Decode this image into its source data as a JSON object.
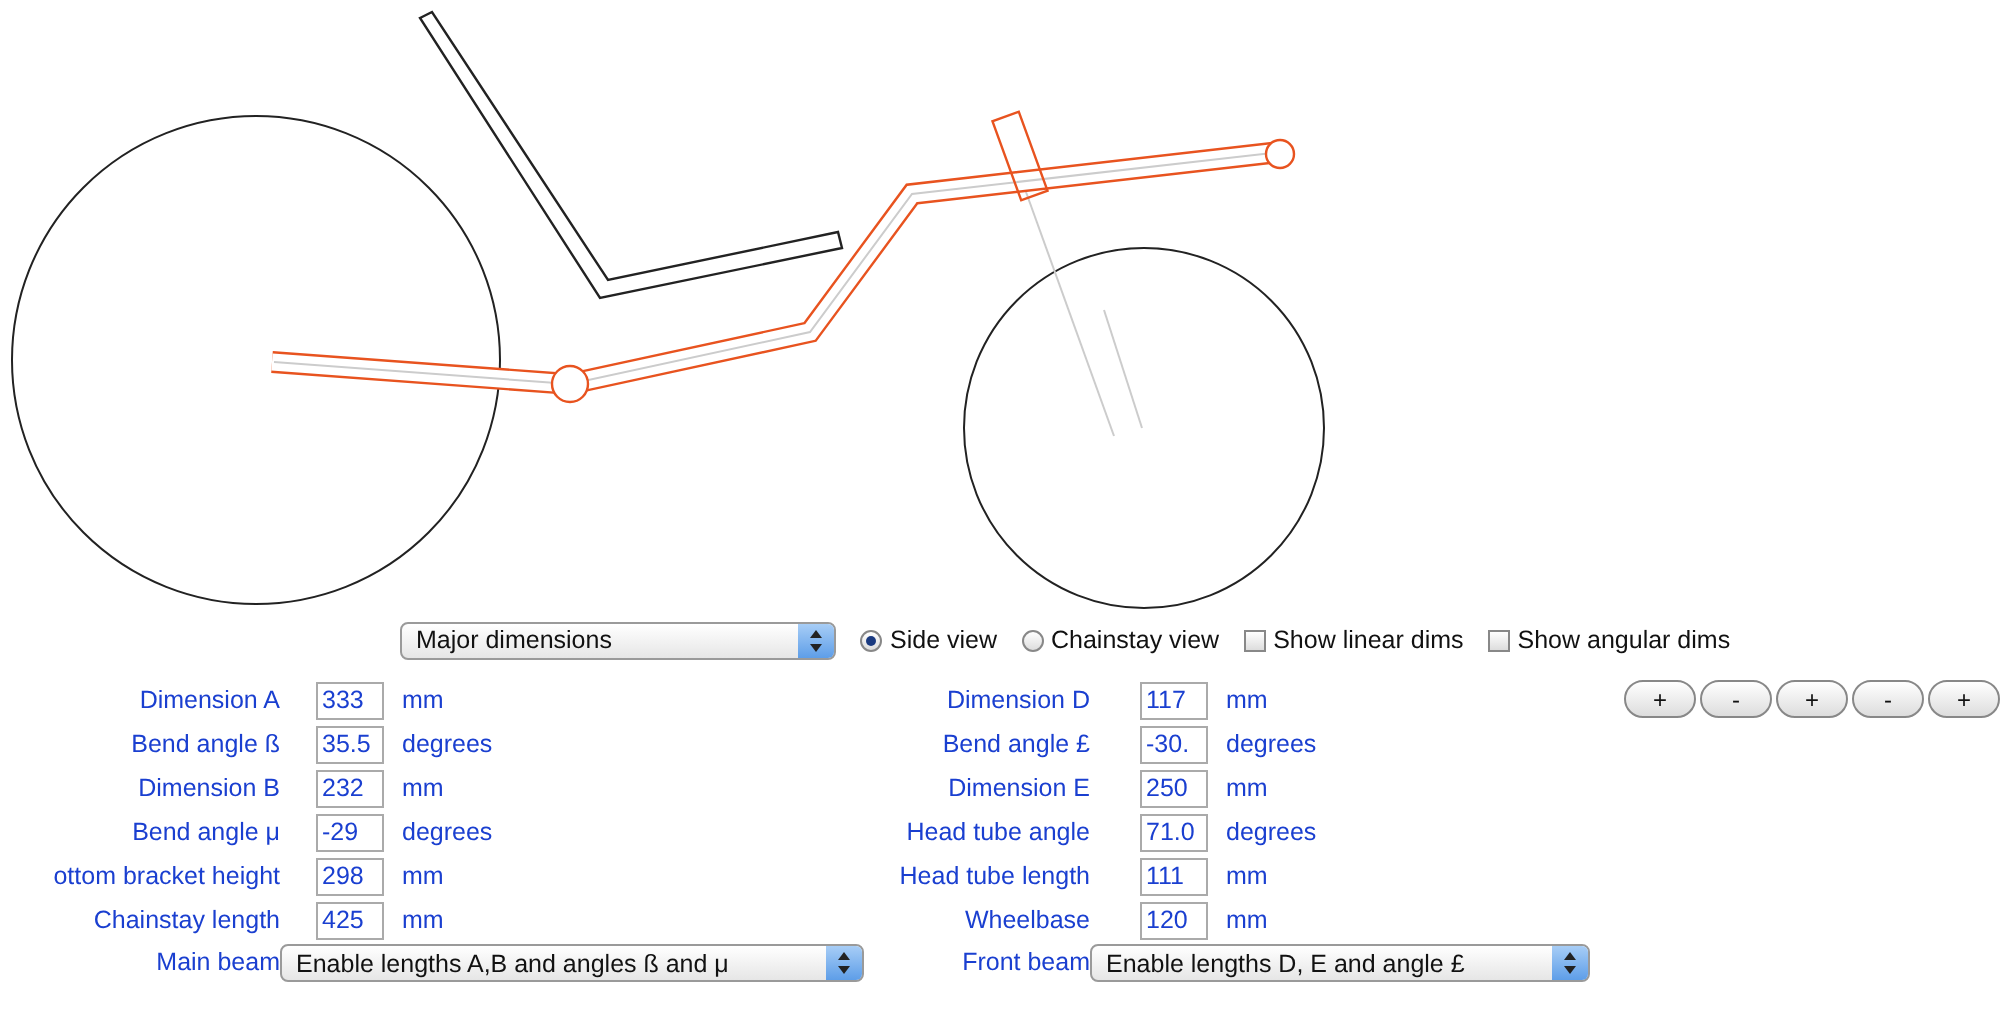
{
  "view_select": {
    "value": "Major dimensions"
  },
  "view_options": [
    {
      "kind": "radio",
      "label": "Side view",
      "selected": true
    },
    {
      "kind": "radio",
      "label": "Chainstay view",
      "selected": false
    },
    {
      "kind": "checkbox",
      "label": "Show linear dims",
      "checked": false
    },
    {
      "kind": "checkbox",
      "label": "Show angular dims",
      "checked": false
    }
  ],
  "left_fields": [
    {
      "label": "Dimension A",
      "value": "333",
      "unit": "mm"
    },
    {
      "label": "Bend angle ß",
      "value": "35.5",
      "unit": "degrees"
    },
    {
      "label": "Dimension B",
      "value": "232",
      "unit": "mm"
    },
    {
      "label": "Bend angle μ",
      "value": "-29",
      "unit": "degrees"
    },
    {
      "label": "ottom bracket height",
      "value": "298",
      "unit": "mm"
    },
    {
      "label": "Chainstay length",
      "value": "425",
      "unit": "mm"
    }
  ],
  "main_beam": {
    "label": "Main beam",
    "value": "Enable lengths A,B and angles ß and μ"
  },
  "right_fields": [
    {
      "label": "Dimension D",
      "value": "117",
      "unit": "mm"
    },
    {
      "label": "Bend angle £",
      "value": "-30.",
      "unit": "degrees"
    },
    {
      "label": "Dimension E",
      "value": "250",
      "unit": "mm"
    },
    {
      "label": "Head tube angle",
      "value": "71.0",
      "unit": "degrees"
    },
    {
      "label": "Head tube length",
      "value": "111",
      "unit": "mm"
    },
    {
      "label": "Wheelbase",
      "value": "120",
      "unit": "mm"
    }
  ],
  "front_beam": {
    "label": "Front beam",
    "value": "Enable lengths D, E and angle £"
  },
  "step_buttons": [
    "+",
    "-",
    "+",
    "-",
    "+"
  ]
}
